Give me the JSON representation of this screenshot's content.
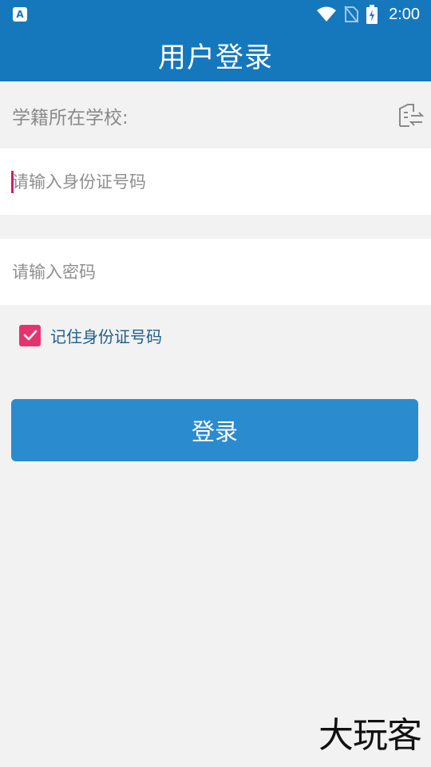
{
  "status_bar": {
    "time": "2:00",
    "icons": [
      "app-notification-icon",
      "wifi-icon",
      "no-sim-icon",
      "battery-charging-icon"
    ]
  },
  "header": {
    "title": "用户登录"
  },
  "school": {
    "label": "学籍所在学校:",
    "icon": "switch-school-icon"
  },
  "form": {
    "id_placeholder": "请输入身份证号码",
    "id_value": "",
    "password_placeholder": "请输入密码",
    "password_value": "",
    "remember_label": "记住身份证号码",
    "remember_checked": true,
    "login_label": "登录"
  },
  "watermark": "大玩客",
  "colors": {
    "primary": "#1578bd",
    "button": "#2a8bcf",
    "checkbox": "#e6336f",
    "background": "#f2f2f2"
  }
}
